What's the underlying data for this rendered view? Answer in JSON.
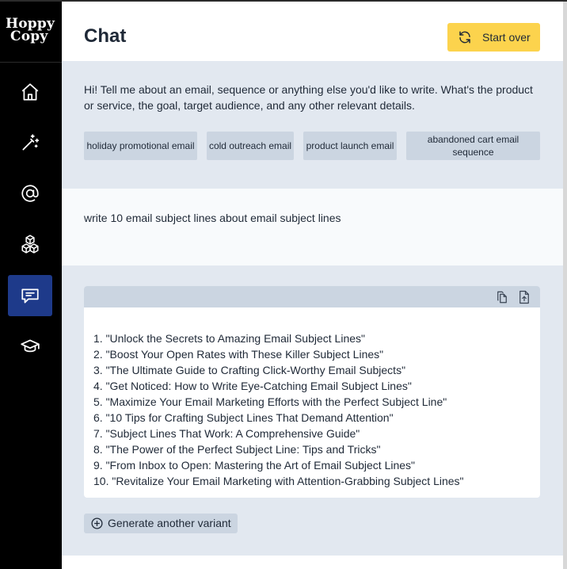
{
  "brand": {
    "logo_line1": "Hoppy",
    "logo_line2": "Copy"
  },
  "sidebar": {
    "items": [
      {
        "icon": "home-icon",
        "active": false
      },
      {
        "icon": "magic-wand-icon",
        "active": false
      },
      {
        "icon": "at-sign-icon",
        "active": false
      },
      {
        "icon": "cubes-icon",
        "active": false
      },
      {
        "icon": "chat-icon",
        "active": true
      },
      {
        "icon": "graduation-cap-icon",
        "active": false
      }
    ]
  },
  "header": {
    "title": "Chat",
    "start_over_label": "Start over"
  },
  "assistant": {
    "message": "Hi! Tell me about an email, sequence or anything else you'd like to write. What's the product or service, the goal, target audience, and any other relevant details.",
    "suggestions": [
      "holiday promotional email",
      "cold outreach email",
      "product launch email",
      "abandoned cart email sequence"
    ]
  },
  "user": {
    "message": "write 10 email subject lines about email subject lines"
  },
  "response": {
    "items": [
      "1. \"Unlock the Secrets to Amazing Email Subject Lines\"",
      "2. \"Boost Your Open Rates with These Killer Subject Lines\"",
      "3. \"The Ultimate Guide to Crafting Click-Worthy Email Subjects\"",
      "4. \"Get Noticed: How to Write Eye-Catching Email Subject Lines\"",
      "5. \"Maximize Your Email Marketing Efforts with the Perfect Subject Line\"",
      "6. \"10 Tips for Crafting Subject Lines That Demand Attention\"",
      "7. \"Subject Lines That Work: A Comprehensive Guide\"",
      "8. \"The Power of the Perfect Subject Line: Tips and Tricks\"",
      "9. \"From Inbox to Open: Mastering the Art of Email Subject Lines\"",
      "10. \"Revitalize Your Email Marketing with Attention-Grabbing Subject Lines\""
    ],
    "generate_label": "Generate another variant"
  },
  "colors": {
    "sidebar_bg": "#000000",
    "active_nav": "#1e3a8a",
    "accent_yellow": "#fcd34d",
    "panel_bg": "#e2e8f0",
    "chip_bg": "#cbd5e1"
  }
}
